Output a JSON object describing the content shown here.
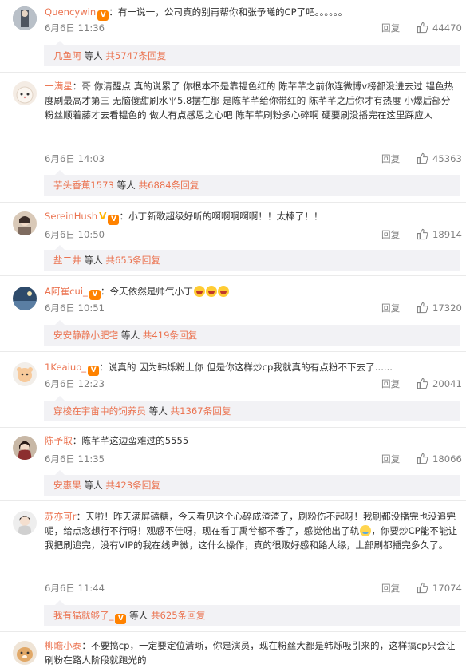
{
  "comments": [
    {
      "user": "Quencywin",
      "text": "：有一说一，公司真的别再帮你和张予曦的CP了吧。。。。。。",
      "time": "6月6日 11:36",
      "reply_label": "回复",
      "likes": "44470",
      "sub_user": "几鱼阿",
      "sub_mid": "等人",
      "sub_count": "共5747条回复"
    },
    {
      "user": "一满星",
      "text": "：哥 你清醒点 真的说累了 你根本不是靠韫色红的 陈芊芊之前你连微博v榜都没进去过 韫色热度刷最高才第三 无脑傻甜刷水平5.8摆在那 是陈芊芊给你带红的 陈芊芊之后你才有热度 小爆后部分粉丝顺着藤才去看韫色的 做人有点感恩之心吧 陈芊芊刷粉多心碎啊 硬要刷没播完在这里踩应人",
      "time": "6月6日 14:03",
      "reply_label": "回复",
      "likes": "45363",
      "sub_user": "芋头香蕉1573",
      "sub_mid": "等人",
      "sub_count": "共6884条回复"
    },
    {
      "user": "SereinHush",
      "text": "：小丁新歌超级好听的啊啊啊啊啊！！太棒了！！",
      "time": "6月6日 10:50",
      "reply_label": "回复",
      "likes": "18914",
      "sub_user": "盐二井",
      "sub_mid": "等人",
      "sub_count": "共655条回复"
    },
    {
      "user": "A阿崔cui_",
      "text": "：今天依然是帅气小丁",
      "time": "6月6日 10:51",
      "reply_label": "回复",
      "likes": "17320",
      "sub_user": "安安静静小肥宅",
      "sub_mid": "等人",
      "sub_count": "共419条回复"
    },
    {
      "user": "1Keaiuo_",
      "text": "：说真的 因为韩烁粉上你 但是你这样炒cp我就真的有点粉不下去了......",
      "time": "6月6日 12:23",
      "reply_label": "回复",
      "likes": "20041",
      "sub_user": "穿梭在宇宙中的饲养员",
      "sub_mid": "等人",
      "sub_count": "共1367条回复"
    },
    {
      "user": "陈予取",
      "text": "：陈芊芊这边蛮难过的5555",
      "time": "6月6日 11:35",
      "reply_label": "回复",
      "likes": "18066",
      "sub_user": "安惠果",
      "sub_mid": "等人",
      "sub_count": "共423条回复"
    },
    {
      "user": "苏亦可r",
      "text_a": "：天啦！昨天满屏磕糖，今天看见这个心碎成渣渣了，刷粉伤不起呀！我刷都没播完也没追完呢，给点念想行不行呀！观感不佳呀，现在看丁禹兮都不香了，感觉他出了轨",
      "text_b": "，你要炒CP能不能让我把刷追完，没有VIP的我在线卑微，这什么操作，真的很败好感和路人缘，上部刷都播完多久了。",
      "time": "6月6日 11:44",
      "reply_label": "回复",
      "likes": "17074",
      "sub_user": "我有猫就够了_",
      "sub_mid": "等人",
      "sub_count": "共625条回复"
    },
    {
      "user": "柳瞻小泰",
      "text": "：不要搞cp，一定要定位清晰，你是演员，现在粉丝大都是韩烁吸引来的，这样搞cp只会让刷粉在路人阶段就跑光的"
    }
  ],
  "colors": {
    "accent": "#eb7350",
    "meta": "#808080",
    "sub_bg": "#f2f2f5"
  }
}
